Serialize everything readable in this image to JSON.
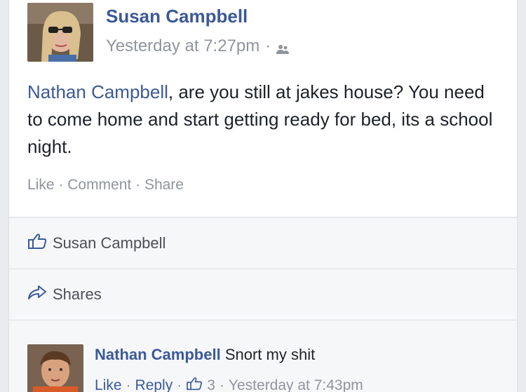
{
  "post": {
    "author": "Susan Campbell",
    "timestamp": "Yesterday at 7:27pm",
    "separator": "·",
    "audience_icon": "friends-icon",
    "mention": "Nathan Campbell",
    "text_rest": ", are you still at jakes house? You need to come home and start getting ready for bed, its a school night.",
    "actions": {
      "like": "Like",
      "comment": "Comment",
      "share": "Share",
      "dot": "·"
    }
  },
  "likes_row": {
    "icon": "thumbs-up-icon",
    "label": "Susan Campbell"
  },
  "shares_row": {
    "icon": "share-arrow-icon",
    "label": "Shares"
  },
  "comment": {
    "author": "Nathan Campbell",
    "text": "Snort my shit",
    "like": "Like",
    "reply": "Reply",
    "like_count": "3",
    "timestamp": "Yesterday at 7:43pm",
    "dot": "·"
  },
  "colors": {
    "link_blue": "#3b5998",
    "meta_grey": "#90949c",
    "background": "#e9ebee"
  }
}
